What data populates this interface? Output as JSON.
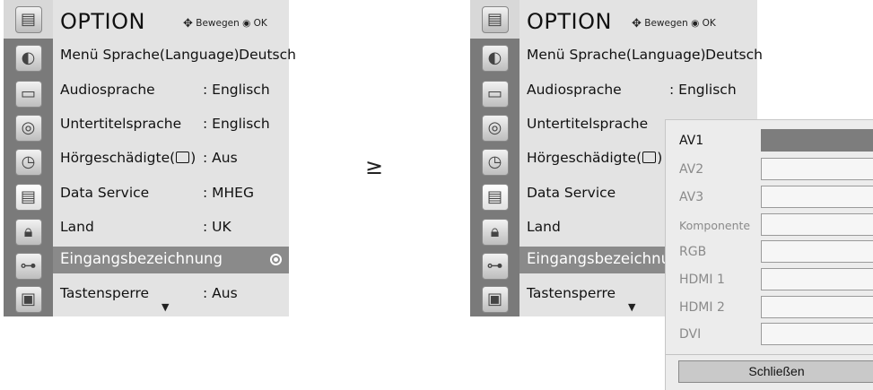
{
  "title": "OPTION",
  "hint": {
    "arrows": "✥",
    "move_label": "Bewegen",
    "dot": "◉",
    "ok_label": "OK"
  },
  "rows": [
    {
      "label": "Menü Sprache(Language)",
      "value": ": Deutsch"
    },
    {
      "label": "Audiosprache",
      "value": ": Englisch"
    },
    {
      "label": "Untertitelsprache",
      "value": ": Englisch"
    },
    {
      "label_pre": "Hörgeschädigte(",
      "label_post": ")",
      "value": ": Aus"
    },
    {
      "label": "Data Service",
      "value": ": MHEG"
    },
    {
      "label": "Land",
      "value": ": UK"
    },
    {
      "label": "Eingangsbezeichnung",
      "value": ""
    },
    {
      "label": "Tastensperre",
      "value": ": Aus"
    }
  ],
  "right_rows": [
    {
      "label": "Menü Sprache(Language)",
      "value": ": Deutsch"
    },
    {
      "label": "Audiosprache",
      "value": ": Englisch"
    },
    {
      "label": "Untertitelsprache"
    },
    {
      "label_pre": "Hörgeschädigte(",
      "label_post": ")"
    },
    {
      "label": "Data Service"
    },
    {
      "label": "Land"
    },
    {
      "label": "Eingangsbezeichnun"
    },
    {
      "label": "Tastensperre"
    }
  ],
  "chevron": "≥",
  "down_arrow": "▼",
  "icons": [
    "option-header-icon",
    "globe-icon",
    "tv-screen-icon",
    "speaker-icon",
    "clock-icon",
    "option-icon",
    "lock-icon",
    "input-plug-icon",
    "pip-icon"
  ],
  "submenu": {
    "items": [
      {
        "label": "AV1",
        "selected": true
      },
      {
        "label": "AV2"
      },
      {
        "label": "AV3"
      },
      {
        "label": "Komponente"
      },
      {
        "label": "RGB"
      },
      {
        "label": "HDMI 1"
      },
      {
        "label": "HDMI 2"
      },
      {
        "label": "DVI"
      }
    ],
    "close_label": "Schließen"
  }
}
